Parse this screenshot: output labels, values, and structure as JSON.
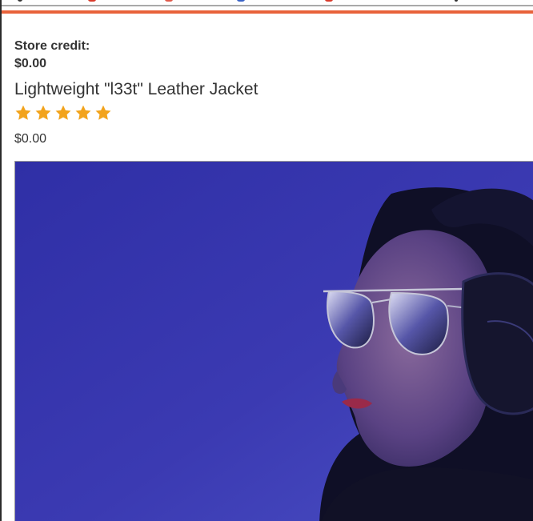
{
  "account": {
    "store_credit_label": "Store credit:",
    "store_credit_value": "$0.00"
  },
  "product": {
    "title": "Lightweight \"l33t\" Leather Jacket",
    "rating": 5,
    "rating_max": 5,
    "price": "$0.00",
    "image_icon": "product-photo-headphones-sunglasses"
  },
  "colors": {
    "accent": "#e8623a",
    "star": "#f2a31c",
    "text": "#333333",
    "photo_background": "#3c3aa8"
  }
}
